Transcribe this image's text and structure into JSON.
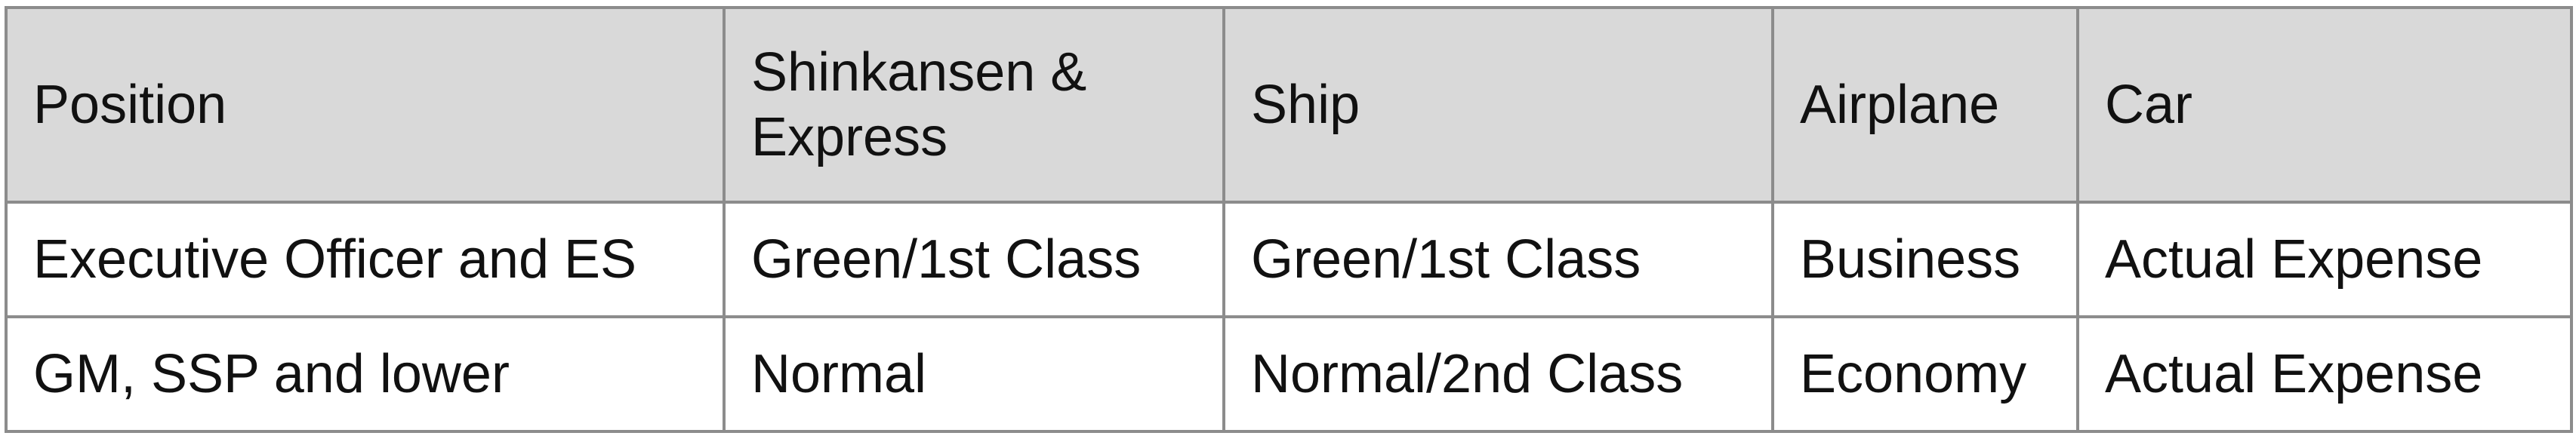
{
  "table": {
    "headers": [
      "Position",
      "Shinkansen & Express",
      "Ship",
      "Airplane",
      "Car"
    ],
    "rows": [
      [
        "Executive Officer and ES",
        "Green/1st Class",
        "Green/1st Class",
        "Business",
        "Actual Expense"
      ],
      [
        "GM, SSP and lower",
        "Normal",
        "Normal/2nd Class",
        "Economy",
        "Actual Expense"
      ]
    ]
  },
  "colors": {
    "header_background": "#d9d9d9",
    "border": "#8c8c8c",
    "text": "#111111"
  }
}
